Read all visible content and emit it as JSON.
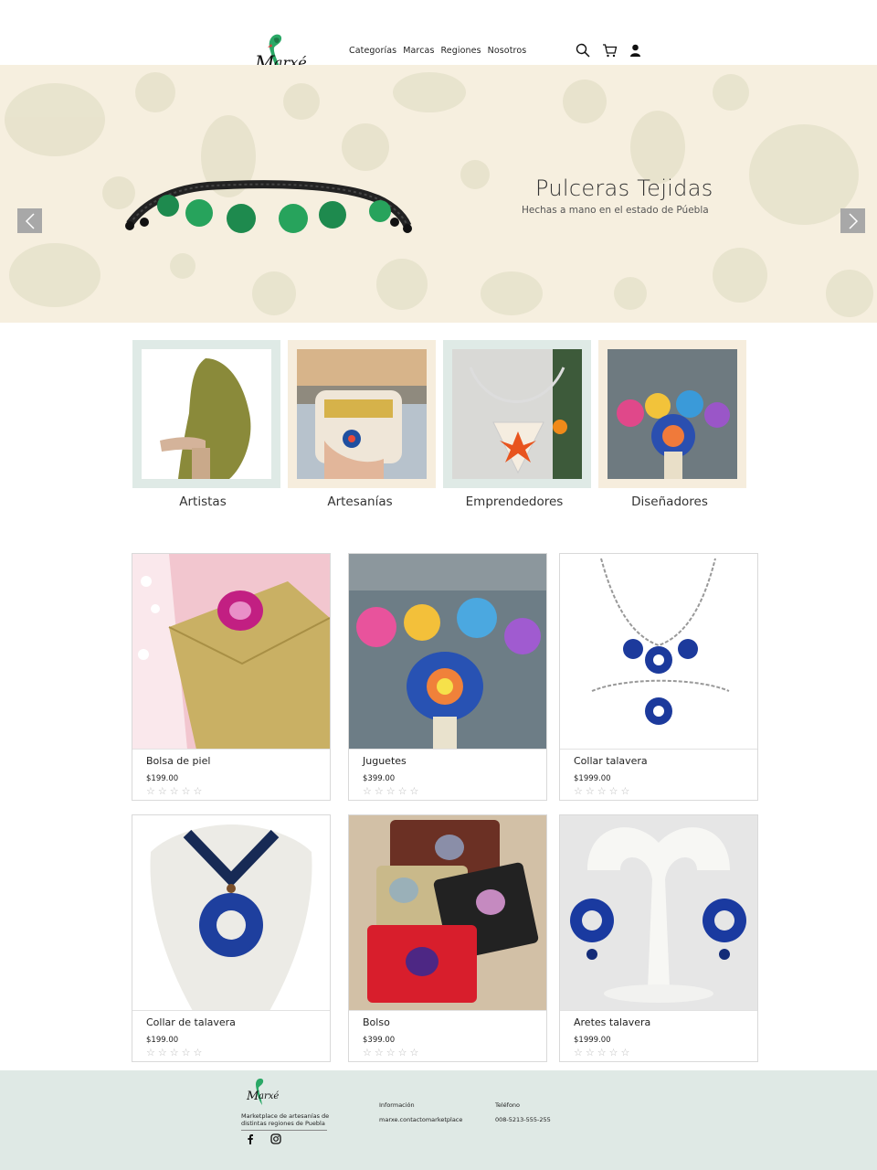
{
  "brand": {
    "name": "Marxé"
  },
  "nav": {
    "items": [
      "Categorías",
      "Marcas",
      "Regiones",
      "Nosotros"
    ]
  },
  "header_icons": [
    "search-icon",
    "cart-icon",
    "user-icon"
  ],
  "hero": {
    "title": "Pulceras Tejidas",
    "subtitle": "Hechas a mano en el estado de Púebla"
  },
  "categories": [
    {
      "label": "Artistas"
    },
    {
      "label": "Artesanías"
    },
    {
      "label": "Emprendedores"
    },
    {
      "label": "Diseñadores"
    }
  ],
  "products": [
    {
      "name": "Bolsa de piel",
      "price": "$199.00",
      "rating": 0
    },
    {
      "name": "Juguetes",
      "price": "$399.00",
      "rating": 0
    },
    {
      "name": "Collar talavera",
      "price": "$1999.00",
      "rating": 0
    },
    {
      "name": "Collar de talavera",
      "price": "$199.00",
      "rating": 0
    },
    {
      "name": "Bolso",
      "price": "$399.00",
      "rating": 0
    },
    {
      "name": "Aretes talavera",
      "price": "$1999.00",
      "rating": 0
    }
  ],
  "footer": {
    "description": "Marketplace de artesanías de distintas regiones de Puebla",
    "info_heading": "Información",
    "email": "marxe.contactomarketplace",
    "phone_heading": "Teléfono",
    "phone": "008-5213-555-255"
  },
  "colors": {
    "hero_bg": "#f6efdf",
    "footer_bg": "#dfe9e5",
    "mint_frame": "#dfeae6",
    "cream_frame": "#f6eddd"
  }
}
